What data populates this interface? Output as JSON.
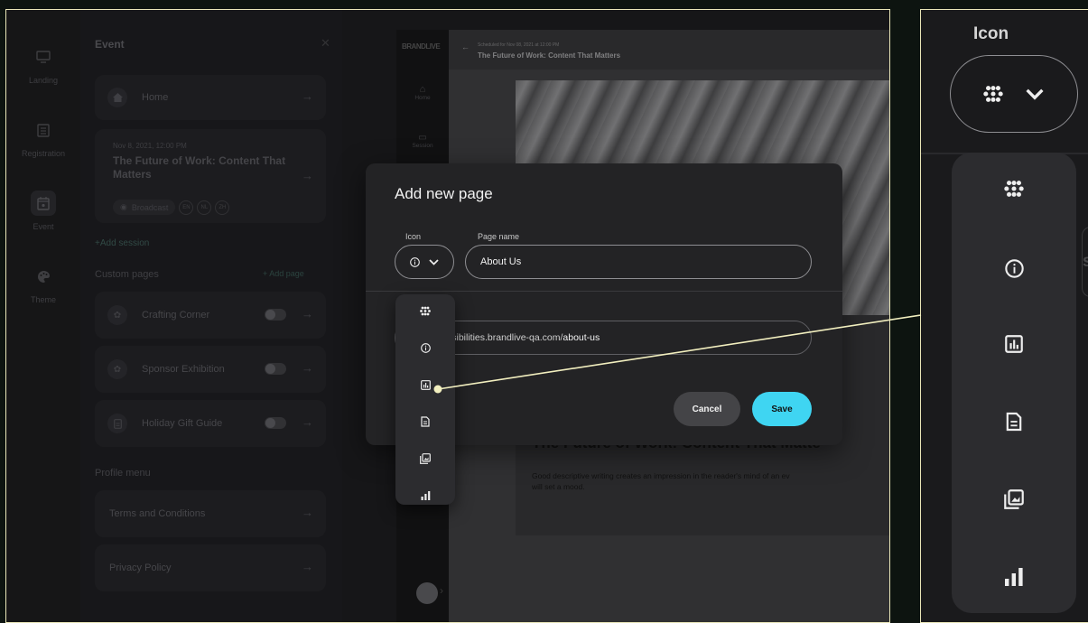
{
  "left_rail": {
    "items": [
      {
        "label": "Landing",
        "icon": "monitor-icon"
      },
      {
        "label": "Registration",
        "icon": "document-list-icon"
      },
      {
        "label": "Event",
        "icon": "calendar-icon"
      },
      {
        "label": "Theme",
        "icon": "palette-icon"
      }
    ]
  },
  "event_panel": {
    "title": "Event",
    "close_label": "✕",
    "home_label": "Home",
    "session": {
      "datetime": "Nov 8, 2021, 12:00 PM",
      "title_line1": "The Future of Work: Content That",
      "title_line2": "Matters",
      "badge": "Broadcast",
      "languages": [
        "EN",
        "NL",
        "ZH"
      ]
    },
    "add_session_label": "+Add session",
    "custom_pages_label": "Custom pages",
    "add_page_label": "+ Add page",
    "custom_pages": [
      {
        "label": "Crafting Corner"
      },
      {
        "label": "Sponsor Exhibition"
      },
      {
        "label": "Holiday Gift Guide"
      }
    ],
    "profile_menu_label": "Profile menu",
    "profile_links": [
      {
        "label": "Terms and Conditions"
      },
      {
        "label": "Privacy Policy"
      }
    ]
  },
  "preview": {
    "logo": "BRANDLIVE",
    "nav": [
      {
        "label": "Home"
      },
      {
        "label": "Session"
      }
    ],
    "back_arrow": "←",
    "scheduled": "Scheduled for Nov 08, 2021 at 12:00 PM",
    "title": "The Future of Work: Content That Matters",
    "hero_title": "The Future of Work: Content That Matte",
    "hero_text_line1": "Good descriptive writing creates an impression in the reader's mind of an ev",
    "hero_text_line2": "will set a mood."
  },
  "modal": {
    "title": "Add new page",
    "icon_label": "Icon",
    "page_name_label": "Page name",
    "page_name_value": "About Us",
    "url_prefix": "ssibilities.brandlive-qa.com/",
    "url_slug": "about-us",
    "cancel_label": "Cancel",
    "save_label": "Save"
  },
  "dropdown": {
    "selected_icon": "info-icon",
    "options": [
      {
        "icon": "flower-icon"
      },
      {
        "icon": "info-icon"
      },
      {
        "icon": "bar-chart-box-icon"
      },
      {
        "icon": "document-icon"
      },
      {
        "icon": "gallery-icon"
      },
      {
        "icon": "signal-bars-icon"
      }
    ]
  },
  "zoom": {
    "title": "Icon",
    "edge_text": "ss"
  },
  "colors": {
    "accent": "#3fd5f2",
    "highlight_border": "#e9e6b8",
    "modal_bg": "#232325",
    "dropdown_bg": "#2c2c2f"
  }
}
